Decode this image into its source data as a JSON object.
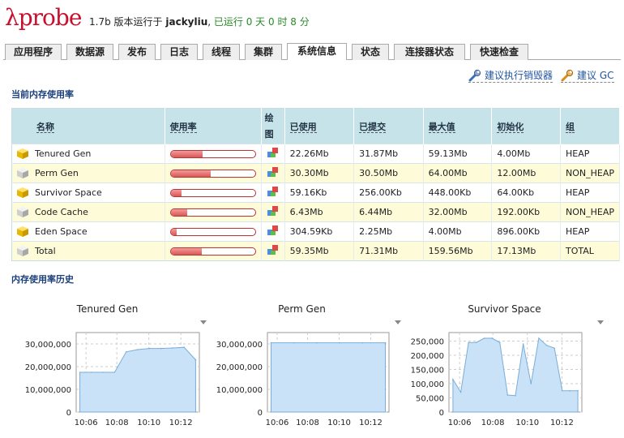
{
  "header": {
    "logo_text": "λprobe",
    "version": "1.7b",
    "running_on": "版本运行于",
    "user": "jackyliu",
    "uptime": "已运行 0 天 0 时 8 分"
  },
  "tabs": [
    {
      "label": "应用程序",
      "active": false
    },
    {
      "label": "数据源",
      "active": false
    },
    {
      "label": "发布",
      "active": false
    },
    {
      "label": "日志",
      "active": false
    },
    {
      "label": "线程",
      "active": false
    },
    {
      "label": "集群",
      "active": false
    },
    {
      "label": "系统信息",
      "active": true
    },
    {
      "label": "状态",
      "active": false
    },
    {
      "label": "连接器状态",
      "active": false
    },
    {
      "label": "快速检查",
      "active": false
    }
  ],
  "actions": {
    "run_finalizer": "建议执行销毁器",
    "run_gc": "建议 GC"
  },
  "memory": {
    "section_title": "当前内存使用率",
    "columns": [
      "名称",
      "使用率",
      "绘图",
      "已使用",
      "已提交",
      "最大值",
      "初始化",
      "组"
    ],
    "rows": [
      {
        "name": "Tenured Gen",
        "usage": 0.38,
        "used": "22.26Mb",
        "committed": "31.87Mb",
        "max": "59.13Mb",
        "init": "4.00Mb",
        "group": "HEAP",
        "cube": "yellow"
      },
      {
        "name": "Perm Gen",
        "usage": 0.47,
        "used": "30.30Mb",
        "committed": "30.50Mb",
        "max": "64.00Mb",
        "init": "12.00Mb",
        "group": "NON_HEAP",
        "cube": "grey"
      },
      {
        "name": "Survivor Space",
        "usage": 0.13,
        "used": "59.16Kb",
        "committed": "256.00Kb",
        "max": "448.00Kb",
        "init": "64.00Kb",
        "group": "HEAP",
        "cube": "yellow"
      },
      {
        "name": "Code Cache",
        "usage": 0.2,
        "used": "6.43Mb",
        "committed": "6.44Mb",
        "max": "32.00Mb",
        "init": "192.00Kb",
        "group": "NON_HEAP",
        "cube": "grey"
      },
      {
        "name": "Eden Space",
        "usage": 0.07,
        "used": "304.59Kb",
        "committed": "2.25Mb",
        "max": "4.00Mb",
        "init": "896.00Kb",
        "group": "HEAP",
        "cube": "yellow"
      },
      {
        "name": "Total",
        "usage": 0.37,
        "used": "59.35Mb",
        "committed": "71.31Mb",
        "max": "159.56Mb",
        "init": "17.13Mb",
        "group": "TOTAL",
        "cube": "grey"
      }
    ]
  },
  "history": {
    "section_title": "内存使用率历史"
  },
  "chart_data": [
    {
      "type": "area",
      "title": "Tenured Gen",
      "xlabel": "",
      "ylabel": "",
      "x": [
        "10:05",
        "10:06",
        "10:07",
        "10:07:40",
        "10:08",
        "10:08:30",
        "10:09",
        "10:10",
        "10:11",
        "10:12",
        "10:12:30"
      ],
      "values": [
        17500000,
        17500000,
        17500000,
        17500000,
        26500000,
        27500000,
        28000000,
        28000000,
        28200000,
        28500000,
        23000000
      ],
      "ylim": [
        0,
        35000000
      ],
      "yticks": [
        "30,000,000",
        "20,000,000",
        "10,000,000",
        "0"
      ],
      "yticks_values": [
        30000000,
        20000000,
        10000000,
        0
      ],
      "xticks": [
        "10:06",
        "10:08",
        "10:10",
        "10:12"
      ]
    },
    {
      "type": "area",
      "title": "Perm Gen",
      "xlabel": "",
      "ylabel": "",
      "x": [
        "10:05",
        "10:06",
        "10:08",
        "10:10",
        "10:12",
        "10:12:30"
      ],
      "values": [
        30500000,
        30500000,
        30500000,
        30500000,
        30500000,
        30500000
      ],
      "ylim": [
        0,
        35000000
      ],
      "yticks": [
        "30,000,000",
        "20,000,000",
        "10,000,000",
        "0"
      ],
      "yticks_values": [
        30000000,
        20000000,
        10000000,
        0
      ],
      "xticks": [
        "10:06",
        "10:08",
        "10:10",
        "10:12"
      ]
    },
    {
      "type": "area",
      "title": "Survivor Space",
      "xlabel": "",
      "ylabel": "",
      "x": [
        0,
        1,
        2,
        3,
        4,
        5,
        6,
        7,
        8,
        9,
        10,
        11,
        12,
        13,
        14,
        15,
        16
      ],
      "values": [
        115000,
        70000,
        245000,
        245000,
        260000,
        260000,
        245000,
        60000,
        58000,
        240000,
        100000,
        260000,
        235000,
        225000,
        75000,
        75000,
        75000
      ],
      "ylim": [
        0,
        280000
      ],
      "yticks": [
        "250,000",
        "200,000",
        "150,000",
        "100,000",
        "50,000",
        "0"
      ],
      "yticks_values": [
        250000,
        200000,
        150000,
        100000,
        50000,
        0
      ],
      "xticks": [
        "10:06",
        "10:08",
        "10:10",
        "10:12"
      ]
    }
  ]
}
